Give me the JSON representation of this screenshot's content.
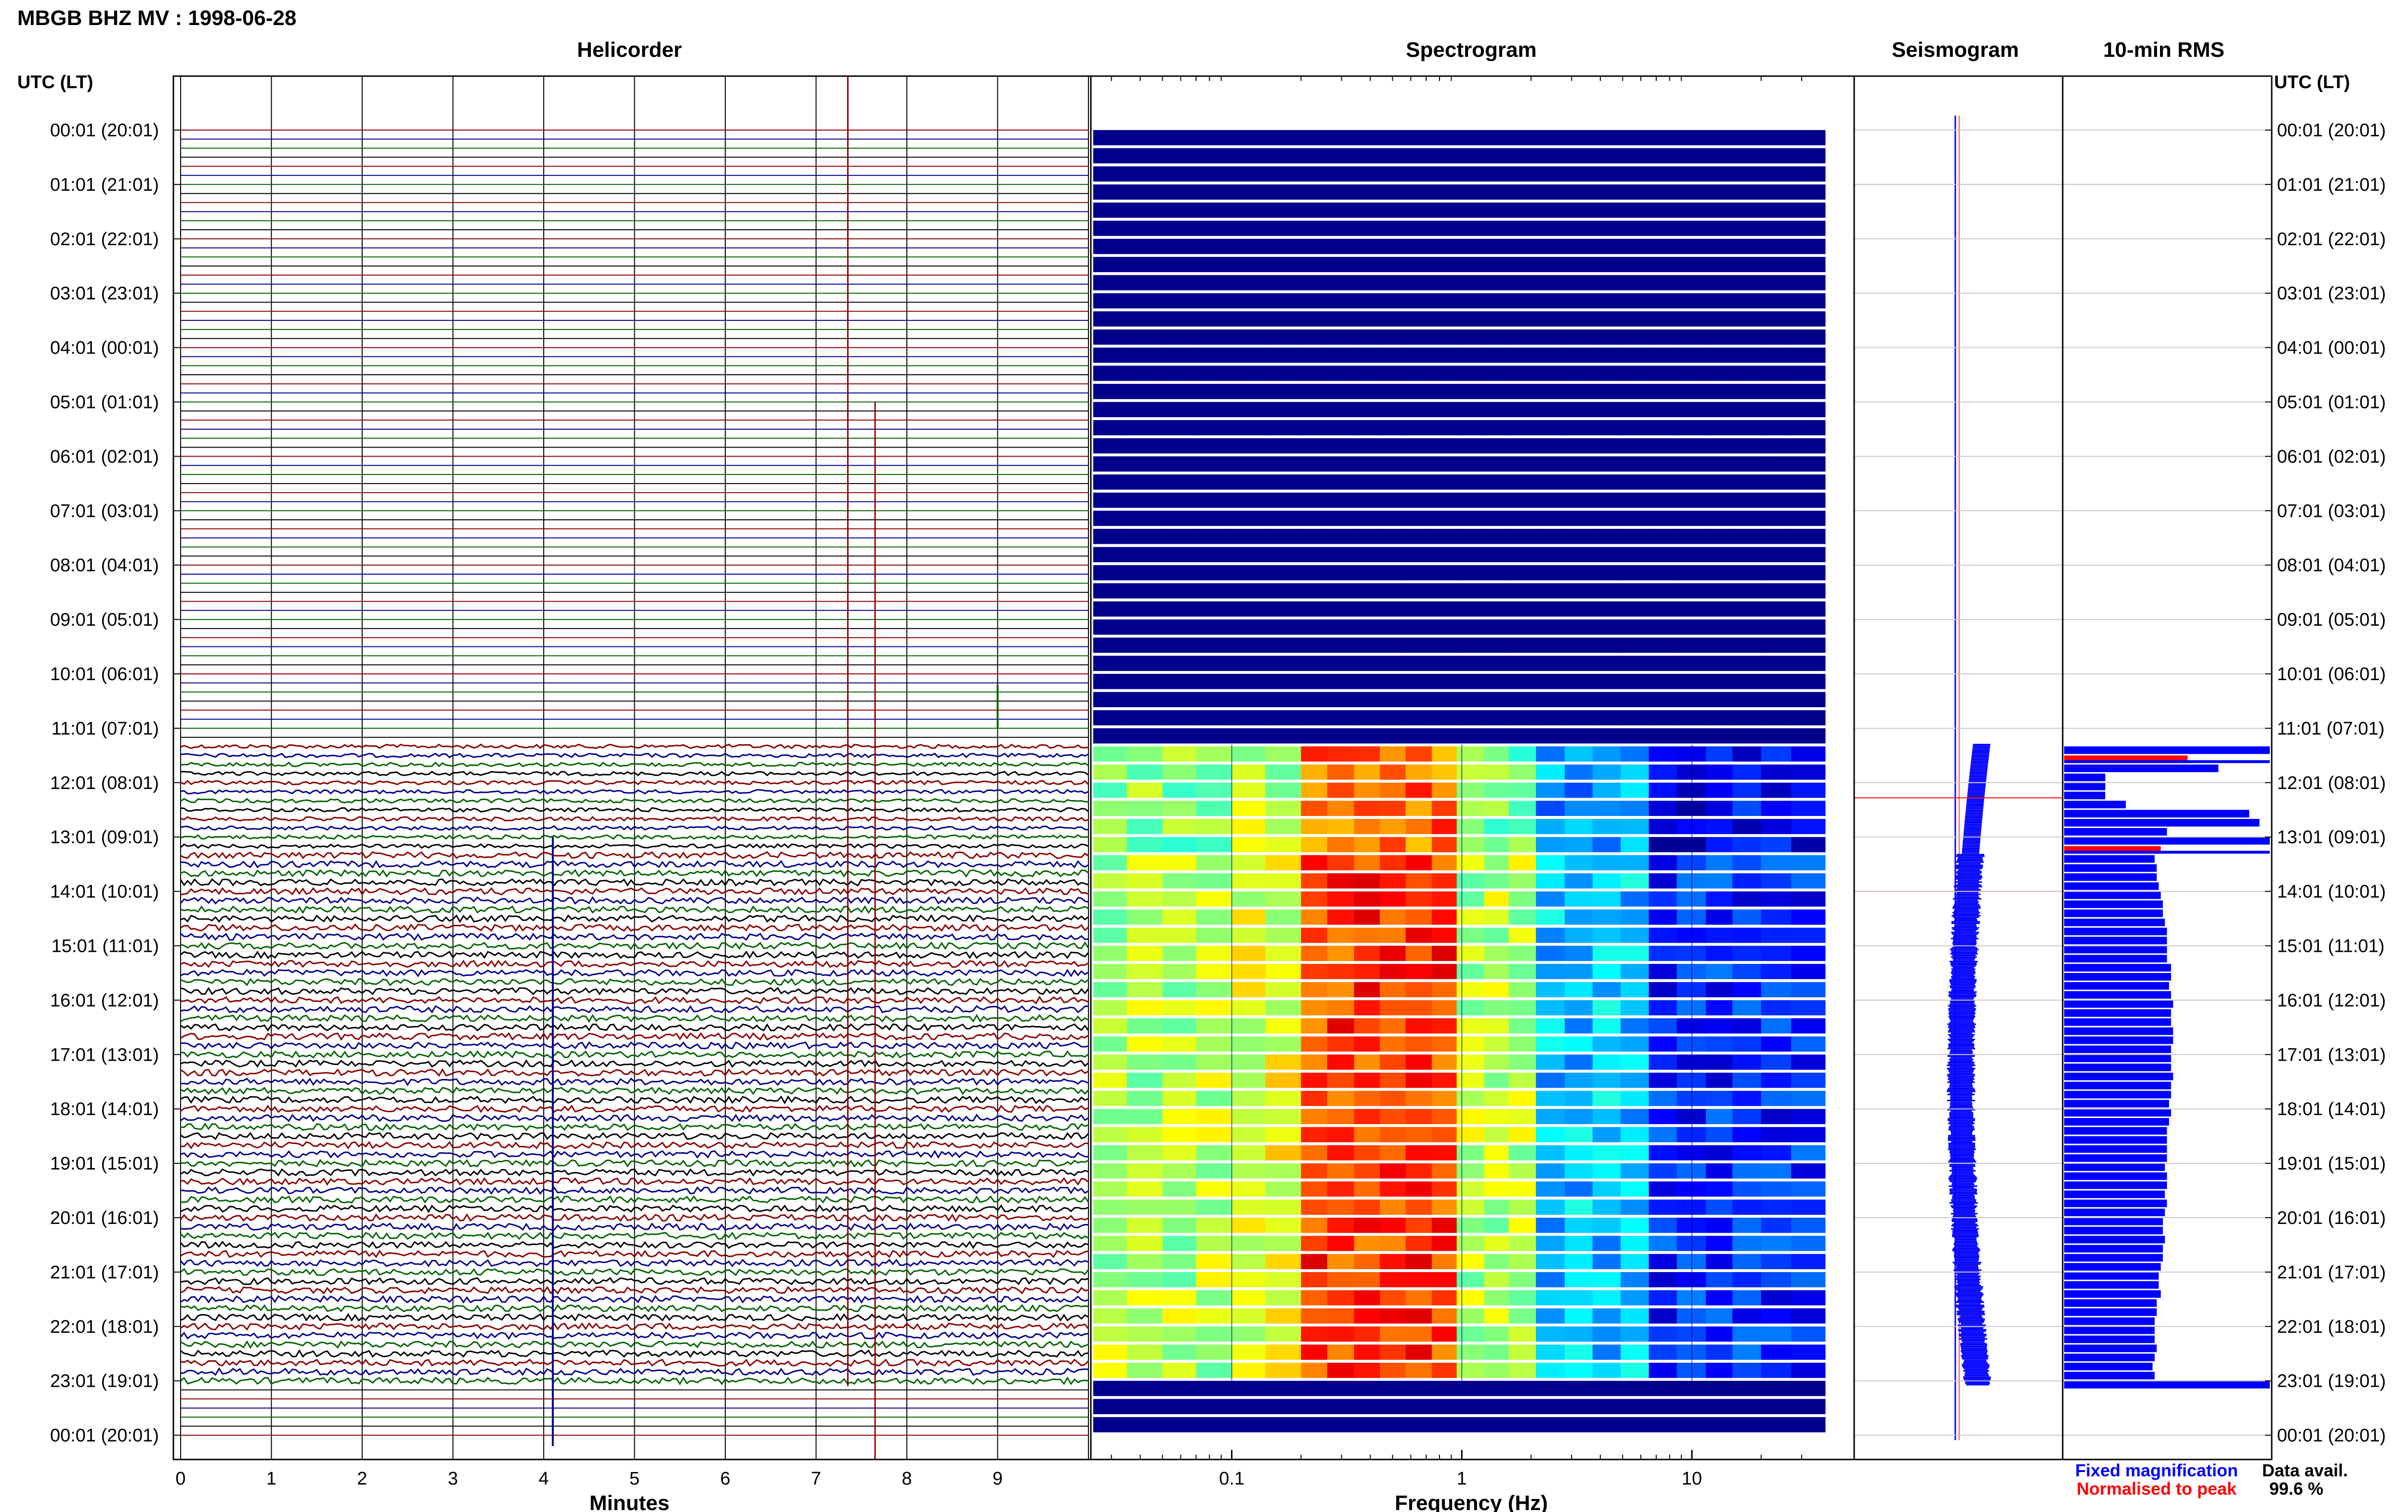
{
  "title": "MBGB BHZ MV : 1998-06-28",
  "panels": {
    "helicorder": "Helicorder",
    "spectrogram": "Spectrogram",
    "seismogram": "Seismogram",
    "rms": "10-min RMS"
  },
  "time_header_left": "UTC (LT)",
  "time_header_right": "UTC (LT)",
  "time_labels": [
    "00:01 (20:01)",
    "01:01 (21:01)",
    "02:01 (22:01)",
    "03:01 (23:01)",
    "04:01 (00:01)",
    "05:01 (01:01)",
    "06:01 (02:01)",
    "07:01 (03:01)",
    "08:01 (04:01)",
    "09:01 (05:01)",
    "10:01 (06:01)",
    "11:01 (07:01)",
    "12:01 (08:01)",
    "13:01 (09:01)",
    "14:01 (10:01)",
    "15:01 (11:01)",
    "16:01 (12:01)",
    "17:01 (13:01)",
    "18:01 (14:01)",
    "19:01 (15:01)",
    "20:01 (16:01)",
    "21:01 (17:01)",
    "22:01 (18:01)",
    "23:01 (19:01)",
    "00:01 (20:01)"
  ],
  "x_axes": {
    "minutes": {
      "label": "Minutes",
      "ticks": [
        "0",
        "1",
        "2",
        "3",
        "4",
        "5",
        "6",
        "7",
        "8",
        "9"
      ]
    },
    "frequency": {
      "label": "Frequency (Hz)",
      "ticks": [
        "0.1",
        "1",
        "10"
      ],
      "scale": "log"
    }
  },
  "legend": {
    "fixed": "Fixed magnification",
    "normalised": "Normalised to peak",
    "fixed_color": "#0000ff",
    "normalised_color": "#ff0000"
  },
  "data_avail_label": "Data avail.",
  "data_avail_value": "99.6 %",
  "colors": {
    "trace_cycle": [
      "#8b0000",
      "#00008b",
      "#006400",
      "#000000"
    ],
    "spectrogram_bg": "#00008b",
    "rms_bar": "#0000ff",
    "rms_peak": "#ff0000"
  },
  "chart_data": {
    "type": "heatmap",
    "station": "MBGB BHZ MV",
    "date": "1998-06-28",
    "data_start_hour": 11.3,
    "data_end_hour": 23.1,
    "spectrogram_peak_hz": [
      0.25,
      0.7
    ],
    "rms_10min_units": [
      1.0,
      0.6,
      0.75,
      0.2,
      0.2,
      0.2,
      0.3,
      0.9,
      0.95,
      0.5,
      1.0,
      0.47,
      0.44,
      0.45,
      0.45,
      0.46,
      0.47,
      0.48,
      0.48,
      0.49,
      0.5,
      0.5,
      0.5,
      0.5,
      0.52,
      0.52,
      0.51,
      0.52,
      0.53,
      0.52,
      0.52,
      0.53,
      0.53,
      0.52,
      0.52,
      0.52,
      0.53,
      0.52,
      0.52,
      0.51,
      0.52,
      0.51,
      0.5,
      0.5,
      0.5,
      0.5,
      0.49,
      0.5,
      0.5,
      0.49,
      0.5,
      0.49,
      0.48,
      0.48,
      0.49,
      0.48,
      0.48,
      0.47,
      0.46,
      0.46,
      0.47,
      0.45,
      0.45,
      0.44,
      0.44,
      0.44,
      0.45,
      0.44,
      0.43,
      0.44,
      1.0
    ],
    "rms_peak_rows": [
      1,
      11
    ]
  }
}
